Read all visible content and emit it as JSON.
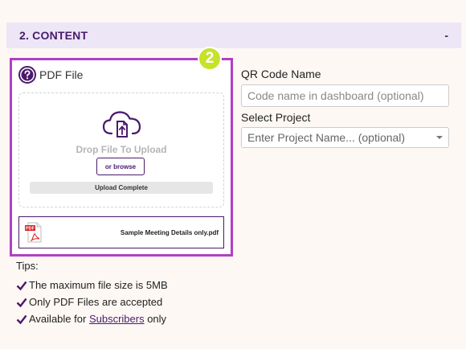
{
  "section": {
    "title": "2. CONTENT",
    "toggle": "-"
  },
  "upload": {
    "step": "2",
    "title": "PDF File",
    "drop_label": "Drop File To Upload",
    "browse_label": "or browse",
    "progress_label": "Upload Complete",
    "progress_fraction": 1.0,
    "file_icon_text": "PDF",
    "file_name": "Sample Meeting Details only.pdf"
  },
  "tips": {
    "label": "Tips:",
    "items": [
      "The maximum file size is 5MB",
      "Only PDF Files are accepted"
    ],
    "subscribers": {
      "prefix": "Available for",
      "link": "Subscribers",
      "suffix": "only"
    }
  },
  "form": {
    "qr_name_label": "QR Code Name",
    "qr_name_placeholder": "Code name in dashboard (optional)",
    "qr_name_value": "",
    "project_label": "Select Project",
    "project_value": "Enter Project Name... (optional)"
  },
  "colors": {
    "accent": "#4a1a6b",
    "panel_border": "#b13fc4",
    "badge": "#c6e22a",
    "header_bg": "#ece6f7",
    "pdf_red": "#d8232a"
  },
  "icons": [
    "help-icon",
    "cloud-upload-icon",
    "pdf-file-icon",
    "check-icon",
    "chevron-down-icon"
  ]
}
